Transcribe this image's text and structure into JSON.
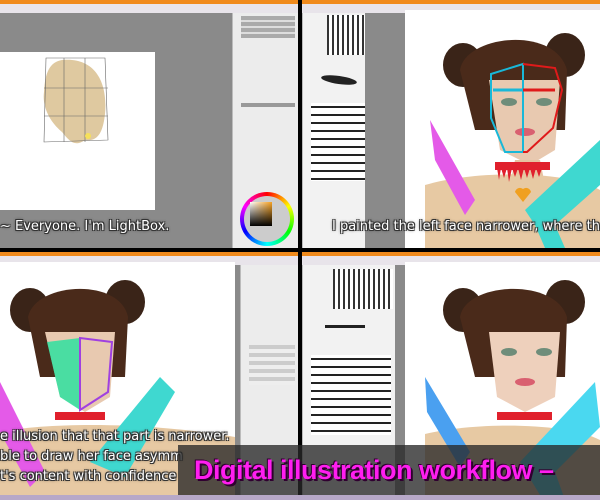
{
  "panels": [
    {
      "subtitle_lines": [
        "~ Everyone. I'm LightBox."
      ]
    },
    {
      "subtitle_lines": [
        "I painted the left face narrower, where th"
      ]
    },
    {
      "subtitle_lines": [
        "e illusion that that part is narrower.",
        "ble to draw her face asymm",
        "t's content with confidence"
      ]
    },
    {
      "subtitle_lines": []
    }
  ],
  "banner": {
    "title": "Digital illustration workflow –"
  },
  "colors": {
    "accent_bar": "#f08a1c",
    "banner_text": "#ff1ef0",
    "face_left": "#19b8d8",
    "face_right": "#e01a1a",
    "knife": "#e45ae8",
    "gun": "#3fd8d0"
  }
}
